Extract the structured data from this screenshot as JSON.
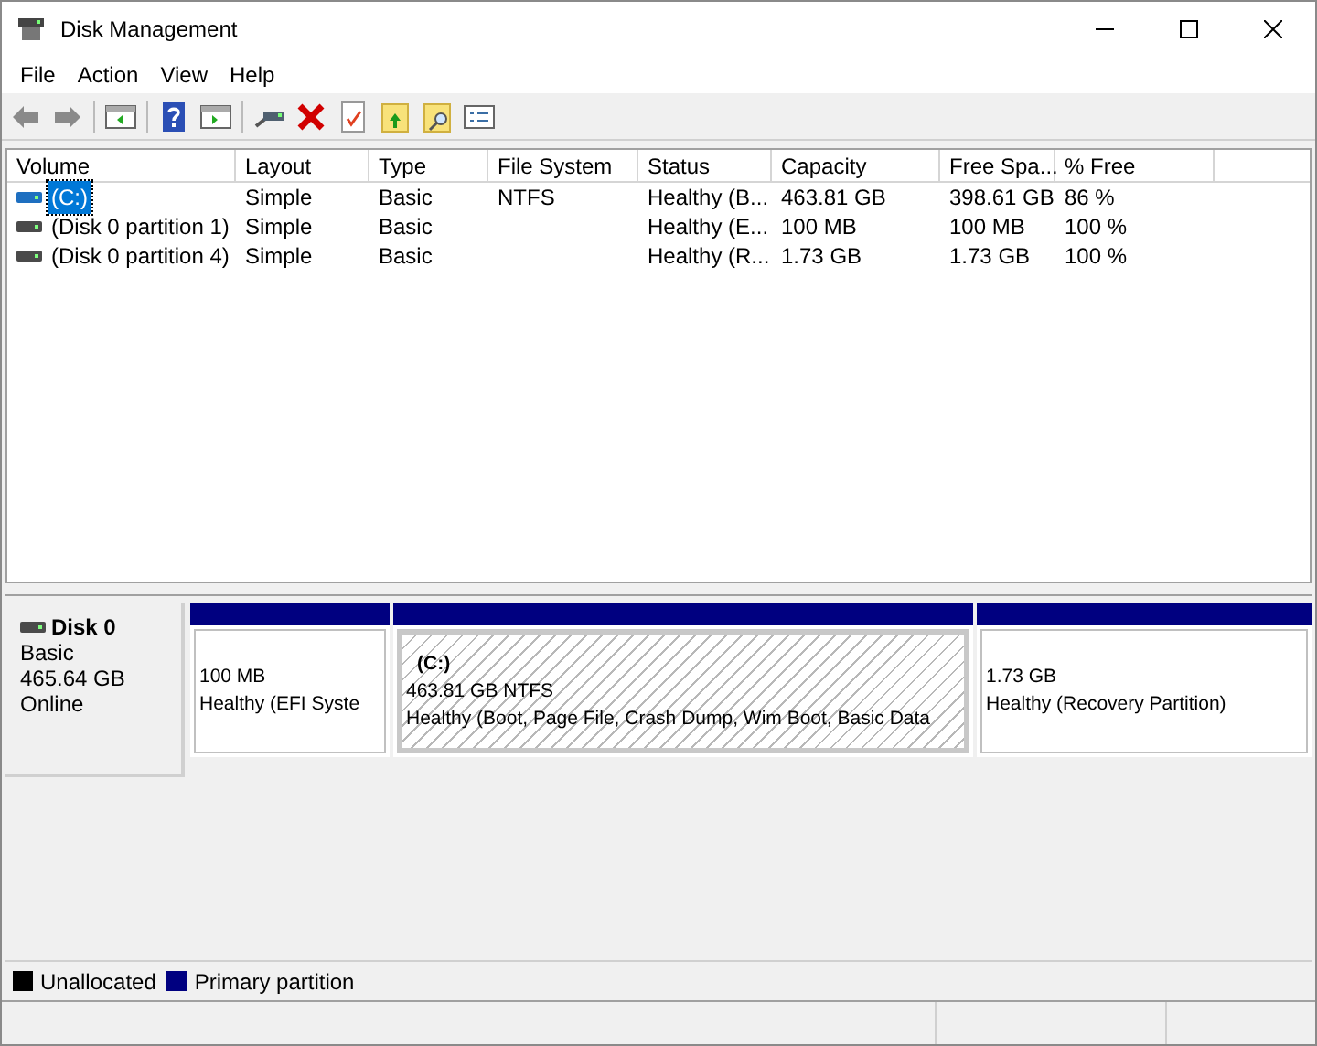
{
  "window": {
    "title": "Disk Management"
  },
  "menu": [
    "File",
    "Action",
    "View",
    "Help"
  ],
  "table": {
    "columns": [
      "Volume",
      "Layout",
      "Type",
      "File System",
      "Status",
      "Capacity",
      "Free Spa...",
      "% Free"
    ],
    "rows": [
      {
        "cells": [
          "(C:)",
          "Simple",
          "Basic",
          "NTFS",
          "Healthy (B...",
          "463.81 GB",
          "398.61 GB",
          "86 %"
        ],
        "selected": true
      },
      {
        "cells": [
          "(Disk 0 partition 1)",
          "Simple",
          "Basic",
          "",
          "Healthy (E...",
          "100 MB",
          "100 MB",
          "100 %"
        ],
        "selected": false
      },
      {
        "cells": [
          "(Disk 0 partition 4)",
          "Simple",
          "Basic",
          "",
          "Healthy (R...",
          "1.73 GB",
          "1.73 GB",
          "100 %"
        ],
        "selected": false
      }
    ]
  },
  "disk": {
    "name": "Disk 0",
    "type": "Basic",
    "size": "465.64 GB",
    "status": "Online",
    "partitions": [
      {
        "size": "100 MB",
        "status": "Healthy (EFI Syste",
        "selected": false
      },
      {
        "label": "(C:)",
        "size": "463.81 GB NTFS",
        "status": "Healthy (Boot, Page File, Crash Dump, Wim Boot, Basic Data",
        "selected": true
      },
      {
        "size": "1.73 GB",
        "status": "Healthy (Recovery Partition)",
        "selected": false
      }
    ]
  },
  "legend": [
    {
      "label": "Unallocated",
      "color": "#000000"
    },
    {
      "label": "Primary partition",
      "color": "#000080"
    }
  ]
}
